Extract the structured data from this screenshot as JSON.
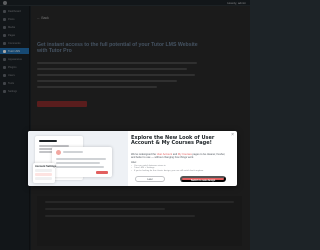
{
  "admin_bar": {
    "greeting": "Howdy, admin"
  },
  "sidebar": {
    "items": [
      {
        "label": "Dashboard"
      },
      {
        "label": "Posts"
      },
      {
        "label": "Media"
      },
      {
        "label": "Pages"
      },
      {
        "label": "Comments"
      },
      {
        "label": "Tutor LMS"
      },
      {
        "label": "Appearance"
      },
      {
        "label": "Plugins"
      },
      {
        "label": "Users"
      },
      {
        "label": "Tools"
      },
      {
        "label": "Settings"
      }
    ]
  },
  "page": {
    "back_link": "← Back",
    "headline": "Get instant access to the full potential of your Tutor LMS Website with Tutor Pro"
  },
  "modal": {
    "title": "Explore the New Look of User Account & My Courses Page!",
    "desc_before": "We've redesigned the ",
    "desc_link1": "User Account",
    "desc_mid": " and ",
    "desc_link2": "My Courses",
    "desc_after": " pages to be cleaner, fresher, and better to use — without changing how things work.",
    "also_label": "Also:",
    "list": [
      "You can switch between views in",
      "Tutor LMS > Settings",
      "If you're looking for the classic design, you can still switch back anytime."
    ],
    "later_label": "Later",
    "switch_label": "Switch to new design",
    "close_glyph": "×",
    "preview_title": "Account Settings"
  },
  "colors": {
    "accent": "#e25f5f",
    "admin_active": "#2271b1"
  }
}
